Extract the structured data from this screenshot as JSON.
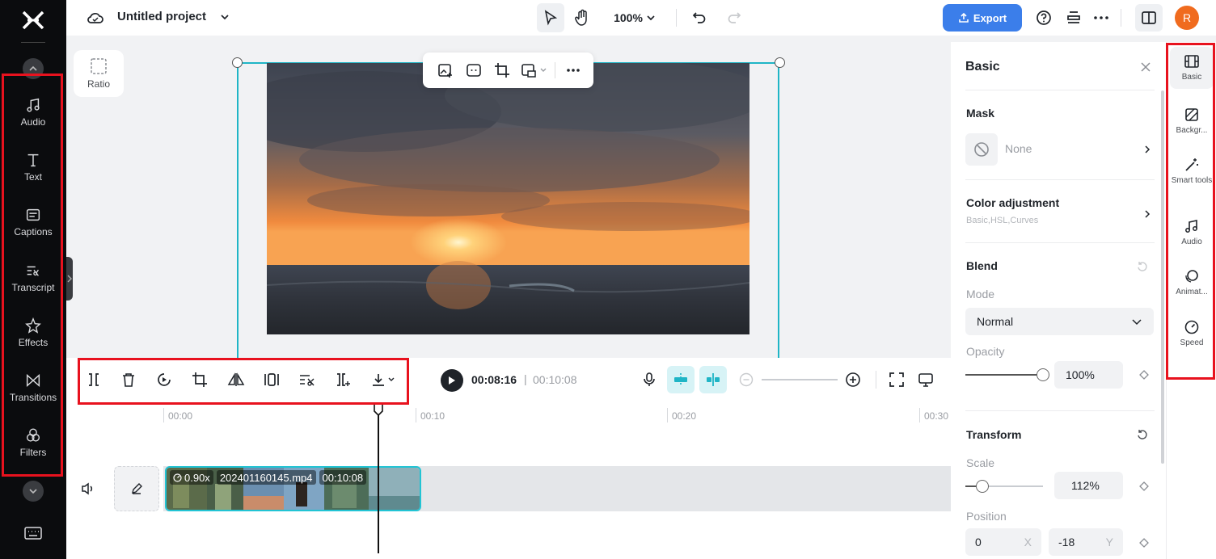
{
  "topbar": {
    "project_title": "Untitled project",
    "zoom": "100%",
    "export_label": "Export",
    "avatar_initial": "R"
  },
  "canvas": {
    "ratio_label": "Ratio"
  },
  "left_sidebar": {
    "items": [
      {
        "label": "Audio",
        "icon": "music-note-icon"
      },
      {
        "label": "Text",
        "icon": "text-t-icon"
      },
      {
        "label": "Captions",
        "icon": "captions-icon"
      },
      {
        "label": "Transcript",
        "icon": "transcript-icon"
      },
      {
        "label": "Effects",
        "icon": "sparkle-star-icon"
      },
      {
        "label": "Transitions",
        "icon": "bowtie-icon"
      },
      {
        "label": "Filters",
        "icon": "three-circles-icon"
      }
    ]
  },
  "playback": {
    "current_time": "00:08:16",
    "separator": "|",
    "total_time": "00:10:08"
  },
  "timeline": {
    "ruler": [
      "00:00",
      "00:10",
      "00:20",
      "00:30"
    ],
    "clip": {
      "speed": "0.90x",
      "filename": "202401160145.mp4",
      "duration": "00:10:08"
    }
  },
  "properties": {
    "title": "Basic",
    "mask": {
      "title": "Mask",
      "value": "None"
    },
    "color_adjustment": {
      "title": "Color adjustment",
      "subtitle": "Basic,HSL,Curves"
    },
    "blend": {
      "title": "Blend",
      "mode_label": "Mode",
      "mode_value": "Normal",
      "opacity_label": "Opacity",
      "opacity_value": "100%",
      "opacity_fraction": 1.0
    },
    "transform": {
      "title": "Transform",
      "scale_label": "Scale",
      "scale_value": "112%",
      "position_label": "Position",
      "position_x": "0",
      "x_axis": "X",
      "position_y": "-18",
      "y_axis": "Y"
    }
  },
  "right_rail": {
    "items": [
      {
        "label": "Basic",
        "icon": "film-icon"
      },
      {
        "label": "Backgr...",
        "icon": "background-icon"
      },
      {
        "label": "Smart tools",
        "icon": "magic-wand-icon"
      },
      {
        "label": "Audio",
        "icon": "music-note-icon"
      },
      {
        "label": "Animat...",
        "icon": "animation-icon"
      },
      {
        "label": "Speed",
        "icon": "speedometer-icon"
      }
    ]
  },
  "colors": {
    "accent": "#3b7eea",
    "selection": "#1fb5c6",
    "avatar": "#f06b1e",
    "highlight": "#e8121e"
  }
}
